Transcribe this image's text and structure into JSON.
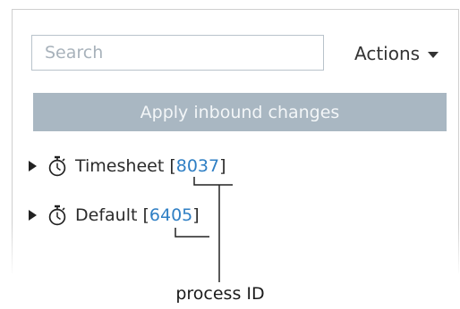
{
  "search": {
    "placeholder": "Search",
    "value": ""
  },
  "actions": {
    "label": "Actions"
  },
  "apply_button": {
    "label": "Apply inbound changes"
  },
  "tree": {
    "items": [
      {
        "name": "Timesheet",
        "process_id": "8037"
      },
      {
        "name": "Default",
        "process_id": "6405"
      }
    ]
  },
  "callout": {
    "label": "process ID"
  },
  "colors": {
    "link": "#2f7fc4",
    "apply_button_bg": "#a9b7c2",
    "apply_button_text": "#f3f6f8",
    "input_border": "#b9c3cb"
  },
  "icons": {
    "expander": "triangle-right-icon",
    "process": "stopwatch-icon",
    "actions_caret": "caret-down-icon"
  }
}
